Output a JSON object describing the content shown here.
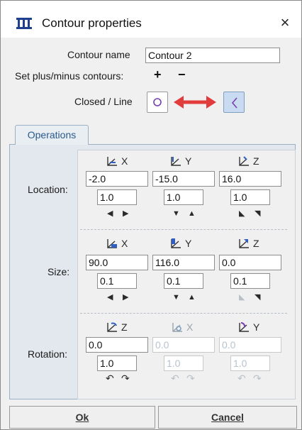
{
  "window": {
    "title": "Contour properties",
    "close_glyph": "×"
  },
  "form": {
    "contour_name_label": "Contour name",
    "contour_name_value": "Contour 2",
    "plusminus_label": "Set plus/minus contours:",
    "plus_glyph": "+",
    "minus_glyph": "−",
    "closed_line_label": "Closed / Line",
    "closed_icon": "circle-icon",
    "line_icon": "open-line-icon",
    "arrow_icon": "double-arrow-icon"
  },
  "tabs": [
    {
      "label": "Operations"
    }
  ],
  "operations": {
    "location": {
      "label": "Location:",
      "axes": [
        "X",
        "Y",
        "Z"
      ],
      "values": [
        "-2.0",
        "-15.0",
        "16.0"
      ],
      "steps": [
        "1.0",
        "1.0",
        "1.0"
      ]
    },
    "size": {
      "label": "Size:",
      "axes": [
        "X",
        "Y",
        "Z"
      ],
      "values": [
        "90.0",
        "116.0",
        "0.0"
      ],
      "steps": [
        "0.1",
        "0.1",
        "0.1"
      ]
    },
    "rotation": {
      "label": "Rotation:",
      "axes": [
        "Z",
        "X",
        "Y"
      ],
      "values": [
        "0.0",
        "0.0",
        "0.0"
      ],
      "steps": [
        "1.0",
        "1.0",
        "1.0"
      ]
    }
  },
  "buttons": {
    "ok": "Ok",
    "cancel": "Cancel"
  },
  "colors": {
    "accent": "#2f5fc4",
    "arrow_red": "#e23b3b",
    "tab_text": "#2a5a8c"
  }
}
